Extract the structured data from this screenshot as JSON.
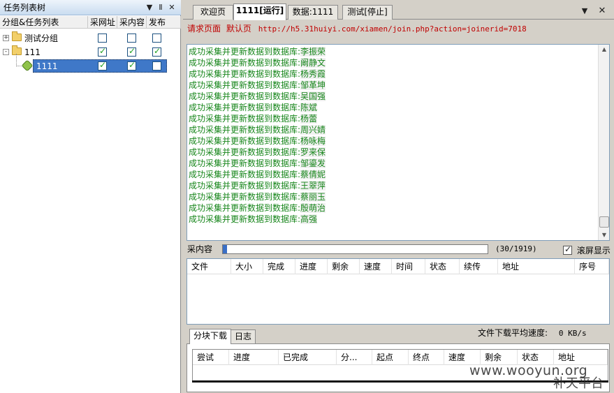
{
  "left_panel": {
    "title": "任务列表树",
    "title_buttons": [
      "▼",
      "Ⅱ",
      "✕"
    ],
    "columns": [
      "分组&任务列表",
      "采网址",
      "采内容",
      "发布"
    ],
    "tree": [
      {
        "label": "测试分组",
        "expander": "+",
        "type": "folder",
        "checks": [
          false,
          false,
          false
        ]
      },
      {
        "label": "111",
        "expander": "-",
        "type": "folder",
        "checks": [
          true,
          true,
          true
        ]
      },
      {
        "label": "1111",
        "expander": "",
        "type": "task",
        "checks": [
          true,
          true,
          false
        ],
        "selected": true
      }
    ]
  },
  "tabs": [
    {
      "label": "欢迎页",
      "active": false
    },
    {
      "label": "1111[运行]",
      "active": true
    },
    {
      "label": "数据:1111",
      "active": false
    },
    {
      "label": "测试[停止]",
      "active": false
    }
  ],
  "tab_controls": {
    "dropdown": "▼",
    "close": "✕"
  },
  "request": {
    "label": "请求页面",
    "page_name": "默认页",
    "url": "http://h5.31huiyi.com/xiamen/join.php?action=joinerid=7018"
  },
  "log": {
    "prefix": "成功采集并更新数据到数据库:",
    "names": [
      "李振荣",
      "阚静文",
      "杨秀霞",
      "邹革坤",
      "吴国强",
      "陈斌",
      "杨蕾",
      "周兴婧",
      "杨咏梅",
      "罗来保",
      "邹鎏发",
      "蔡倩妮",
      "王翠萍",
      "蔡丽玉",
      "殷萌治",
      "高强"
    ]
  },
  "progress": {
    "label": "采内容",
    "fraction": 0.0156,
    "count": "(30/1919)",
    "auto_scroll_label": "滚屏显示",
    "auto_scroll": true
  },
  "file_table": {
    "columns": [
      "文件",
      "大小",
      "完成",
      "进度",
      "剩余",
      "速度",
      "时间",
      "状态",
      "续传",
      "地址",
      "序号"
    ]
  },
  "avg_speed": {
    "label": "文件下载平均速度:",
    "value": "0 KB/s"
  },
  "bottom_tabs": [
    {
      "label": "分块下载",
      "active": true
    },
    {
      "label": "日志",
      "active": false
    }
  ],
  "block_table": {
    "columns": [
      "尝试",
      "进度",
      "已完成",
      "分...",
      "起点",
      "终点",
      "速度",
      "剩余",
      "状态",
      "地址"
    ]
  },
  "watermark": {
    "site": "www.wooyun.org",
    "sub": "补天平台"
  }
}
